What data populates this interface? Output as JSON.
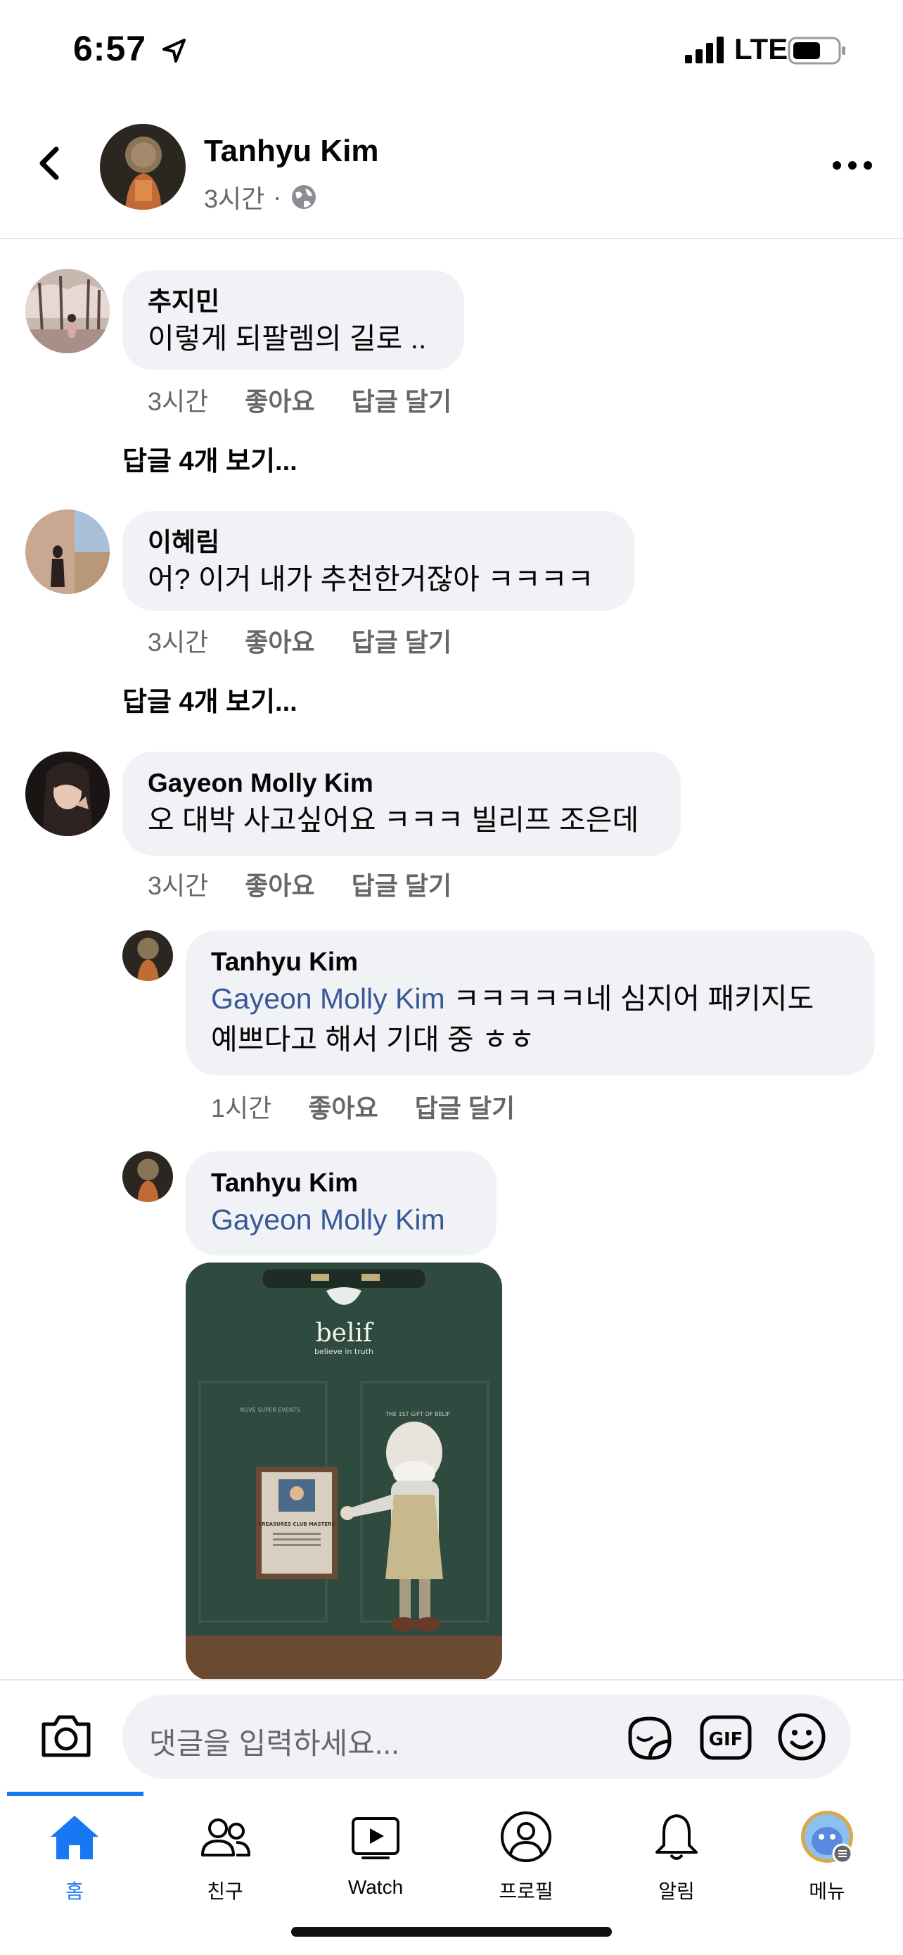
{
  "status_bar": {
    "time": "6:57",
    "network": "LTE"
  },
  "header": {
    "name": "Tanhyu Kim",
    "time": "3시간",
    "separator": "·"
  },
  "comments": [
    {
      "author": "추지민",
      "text": "이렇게 되팔렘의 길로 ..",
      "time": "3시간",
      "like": "좋아요",
      "reply": "답글 달기",
      "view_replies": "답글 4개 보기..."
    },
    {
      "author": "이혜림",
      "text": "어? 이거 내가 추천한거잖아 ㅋㅋㅋㅋ",
      "time": "3시간",
      "like": "좋아요",
      "reply": "답글 달기",
      "view_replies": "답글 4개 보기..."
    },
    {
      "author": "Gayeon Molly Kim",
      "text": "오 대박 사고싶어요 ㅋㅋㅋ 빌리프 조은데",
      "time": "3시간",
      "like": "좋아요",
      "reply": "답글 달기"
    }
  ],
  "replies": [
    {
      "author": "Tanhyu Kim",
      "mention": "Gayeon Molly Kim",
      "text_line1": " ㅋㅋㅋㅋㅋ네 심지어 패키지도",
      "text_line2": "예쁘다고 해서 기대 중 ㅎㅎ",
      "time": "1시간",
      "like": "좋아요",
      "reply": "답글 달기"
    },
    {
      "author": "Tanhyu Kim",
      "mention": "Gayeon Molly Kim",
      "photo_brand": "belif",
      "photo_tagline": "believe in truth",
      "photo_text_left": "NOVE SUPER EVENTS",
      "photo_text_right": "THE 1ST GIFT OF BELIF",
      "photo_frame_text": "TREASURES CLUB MASTERS"
    }
  ],
  "composer": {
    "placeholder": "댓글을 입력하세요..."
  },
  "tabs": [
    {
      "label": "홈",
      "icon": "home-icon",
      "active": true
    },
    {
      "label": "친구",
      "icon": "friends-icon"
    },
    {
      "label": "Watch",
      "icon": "watch-icon"
    },
    {
      "label": "프로필",
      "icon": "profile-icon"
    },
    {
      "label": "알림",
      "icon": "bell-icon"
    },
    {
      "label": "메뉴",
      "icon": "menu-avatar-icon"
    }
  ],
  "colors": {
    "accent": "#1877f2",
    "mention": "#385898",
    "bubble": "#f0f2f5",
    "secondary_text": "#65676b"
  }
}
